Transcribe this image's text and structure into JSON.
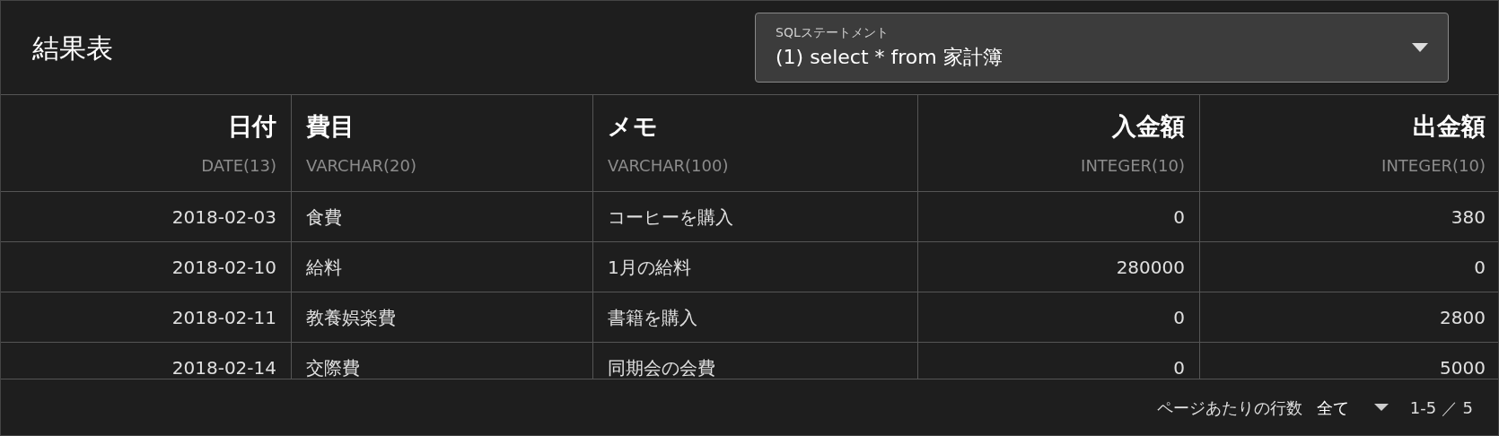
{
  "title": "結果表",
  "statement_select": {
    "label": "SQLステートメント",
    "value": "(1) select * from 家計簿"
  },
  "table": {
    "columns": [
      {
        "name": "日付",
        "type": "DATE(13)"
      },
      {
        "name": "費目",
        "type": "VARCHAR(20)"
      },
      {
        "name": "メモ",
        "type": "VARCHAR(100)"
      },
      {
        "name": "入金額",
        "type": "INTEGER(10)"
      },
      {
        "name": "出金額",
        "type": "INTEGER(10)"
      }
    ],
    "rows": [
      [
        "2018-02-03",
        "食費",
        "コーヒーを購入",
        "0",
        "380"
      ],
      [
        "2018-02-10",
        "給料",
        "1月の給料",
        "280000",
        "0"
      ],
      [
        "2018-02-11",
        "教養娯楽費",
        "書籍を購入",
        "0",
        "2800"
      ],
      [
        "2018-02-14",
        "交際費",
        "同期会の会費",
        "0",
        "5000"
      ]
    ]
  },
  "pagination": {
    "rows_per_page_label": "ページあたりの行数",
    "rows_per_page": "全て",
    "range": "1-5 ／ 5"
  }
}
